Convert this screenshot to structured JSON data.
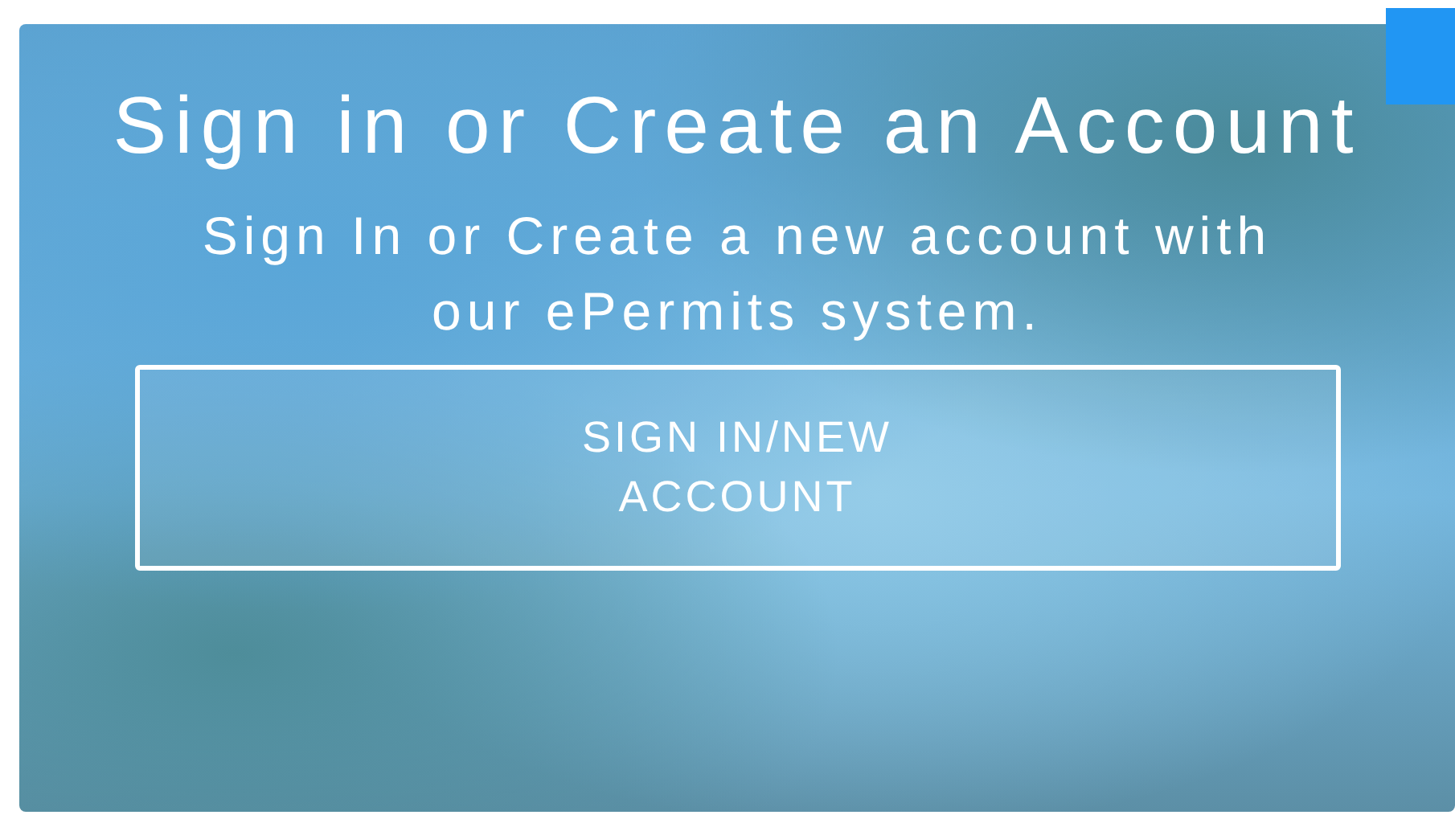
{
  "card": {
    "title": "Sign in or Create an Account",
    "description": "Sign In or Create a new account with our ePermits system.",
    "button": "SIGN IN/NEW ACCOUNT"
  }
}
